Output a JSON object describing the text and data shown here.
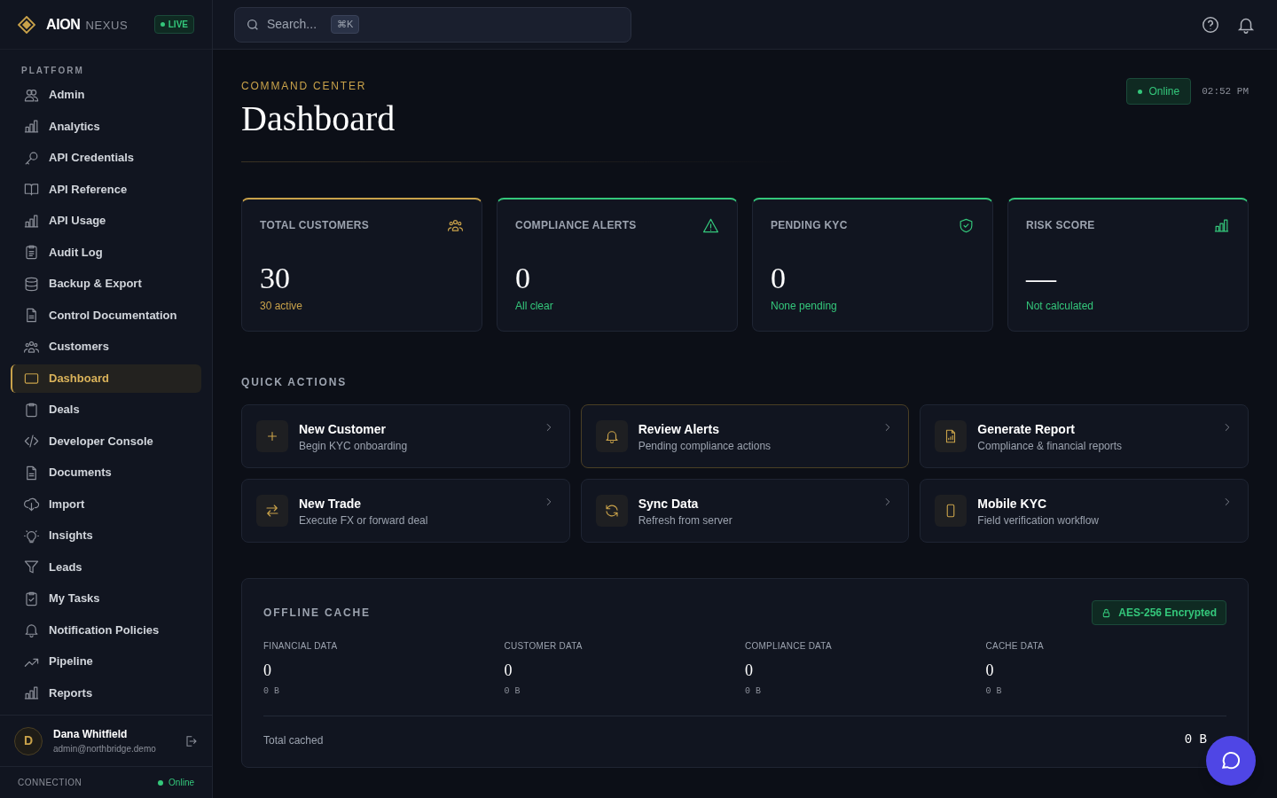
{
  "brand": {
    "name": "AION",
    "suffix": "NEXUS",
    "badge": "LIVE"
  },
  "sidebar": {
    "section": "PLATFORM",
    "items": [
      {
        "label": "Admin",
        "selected": false
      },
      {
        "label": "Analytics",
        "selected": false
      },
      {
        "label": "API Credentials",
        "selected": false
      },
      {
        "label": "API Reference",
        "selected": false
      },
      {
        "label": "API Usage",
        "selected": false
      },
      {
        "label": "Audit Log",
        "selected": false
      },
      {
        "label": "Backup & Export",
        "selected": false
      },
      {
        "label": "Control Documentation",
        "selected": false
      },
      {
        "label": "Customers",
        "selected": false
      },
      {
        "label": "Dashboard",
        "selected": true
      },
      {
        "label": "Deals",
        "selected": false
      },
      {
        "label": "Developer Console",
        "selected": false
      },
      {
        "label": "Documents",
        "selected": false
      },
      {
        "label": "Import",
        "selected": false
      },
      {
        "label": "Insights",
        "selected": false
      },
      {
        "label": "Leads",
        "selected": false
      },
      {
        "label": "My Tasks",
        "selected": false
      },
      {
        "label": "Notification Policies",
        "selected": false
      },
      {
        "label": "Pipeline",
        "selected": false
      },
      {
        "label": "Reports",
        "selected": false
      }
    ],
    "user": {
      "initial": "D",
      "name": "Dana Whitfield",
      "email": "admin@northbridge.demo"
    },
    "connection": {
      "label": "CONNECTION",
      "status": "Online"
    }
  },
  "search": {
    "placeholder": "Search...",
    "shortcut": "⌘K"
  },
  "header": {
    "eyebrow": "COMMAND CENTER",
    "title": "Dashboard",
    "status": "Online",
    "time": "02:52 PM"
  },
  "stats": [
    {
      "label": "TOTAL CUSTOMERS",
      "value": "30",
      "note": "30 active",
      "color": "#c9a24a"
    },
    {
      "label": "COMPLIANCE ALERTS",
      "value": "0",
      "note": "All clear",
      "color": "#34c77b"
    },
    {
      "label": "PENDING KYC",
      "value": "0",
      "note": "None pending",
      "color": "#34c77b"
    },
    {
      "label": "RISK SCORE",
      "value": "—",
      "note": "Not calculated",
      "color": "#34c77b"
    }
  ],
  "quick_actions": {
    "title": "QUICK ACTIONS",
    "items": [
      {
        "title": "New Customer",
        "subtitle": "Begin KYC onboarding",
        "selected": false
      },
      {
        "title": "Review Alerts",
        "subtitle": "Pending compliance actions",
        "selected": true
      },
      {
        "title": "Generate Report",
        "subtitle": "Compliance & financial reports",
        "selected": false
      },
      {
        "title": "New Trade",
        "subtitle": "Execute FX or forward deal",
        "selected": false
      },
      {
        "title": "Sync Data",
        "subtitle": "Refresh from server",
        "selected": false
      },
      {
        "title": "Mobile KYC",
        "subtitle": "Field verification workflow",
        "selected": false
      }
    ]
  },
  "offline_cache": {
    "title": "OFFLINE CACHE",
    "badge": "AES-256 Encrypted",
    "items": [
      {
        "label": "FINANCIAL DATA",
        "value": "0",
        "size": "0 B"
      },
      {
        "label": "CUSTOMER DATA",
        "value": "0",
        "size": "0 B"
      },
      {
        "label": "COMPLIANCE DATA",
        "value": "0",
        "size": "0 B"
      },
      {
        "label": "CACHE DATA",
        "value": "0",
        "size": "0 B"
      }
    ],
    "total_label": "Total cached",
    "total": "0 B"
  }
}
